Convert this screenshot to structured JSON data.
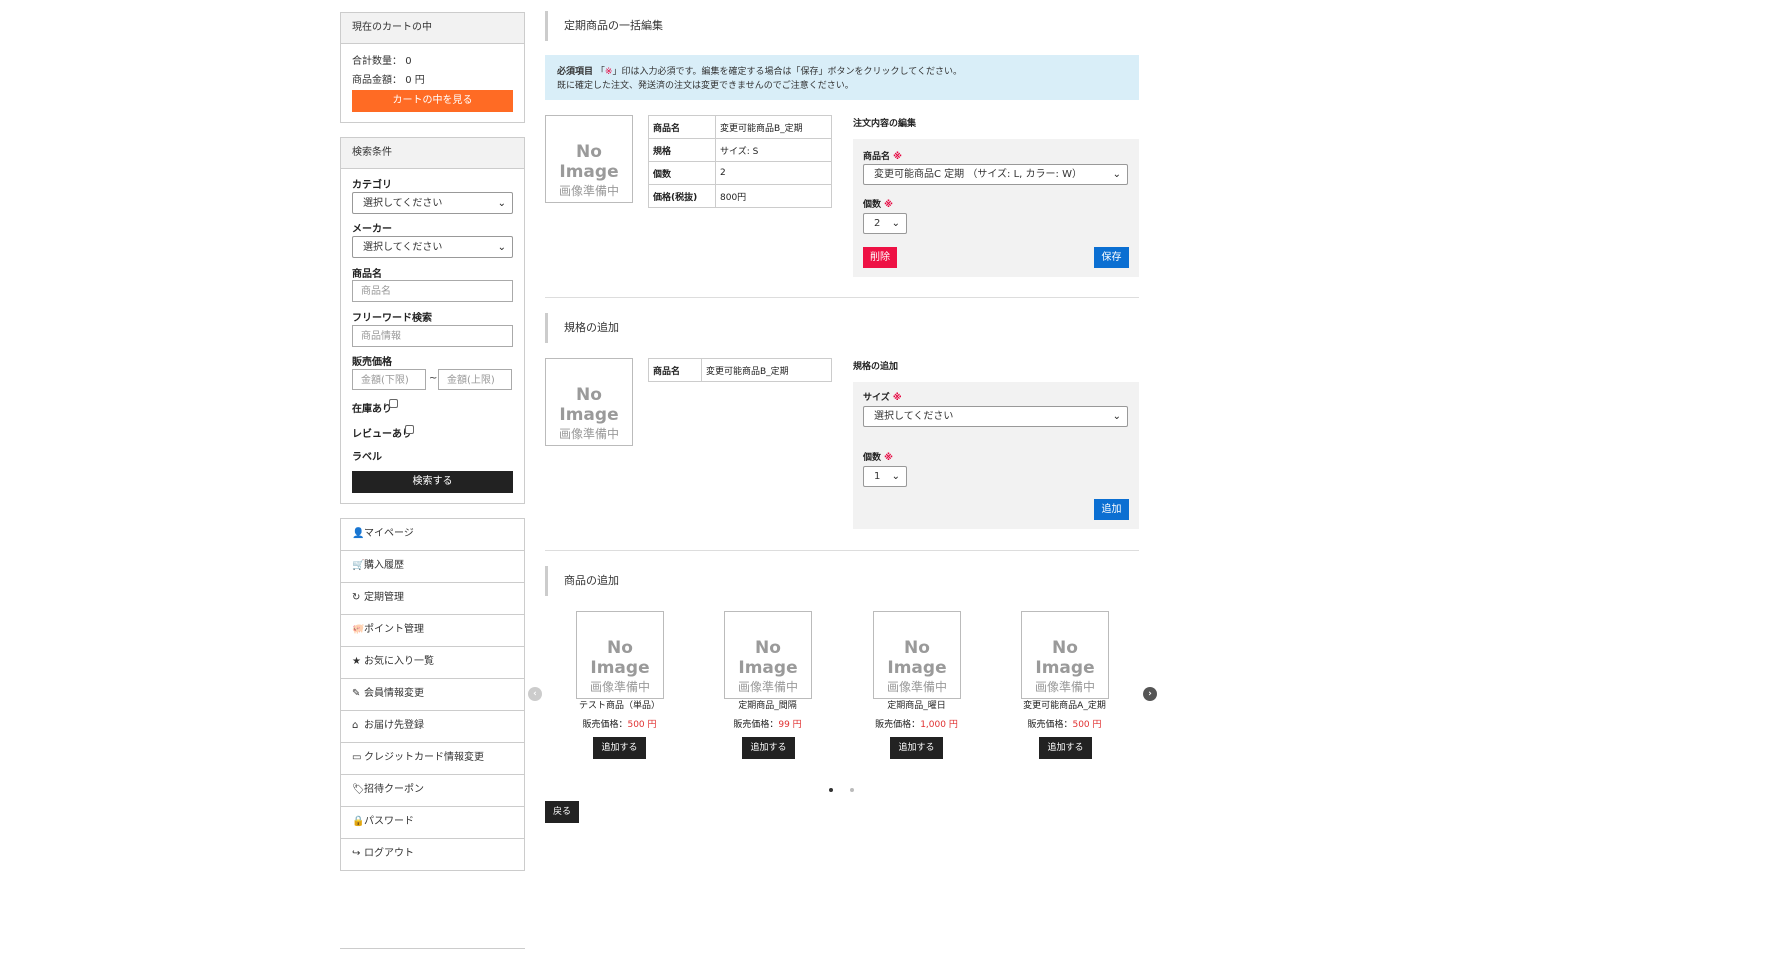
{
  "cart": {
    "title": "現在のカートの中",
    "qty_label": "合計数量：",
    "qty_value": "0",
    "amount_label": "商品金額：",
    "amount_value": "0 円",
    "view_button": "カートの中を見る"
  },
  "search": {
    "title": "検索条件",
    "category_label": "カテゴリ",
    "category_value": "選択してください",
    "maker_label": "メーカー",
    "maker_value": "選択してください",
    "name_label": "商品名",
    "name_placeholder": "商品名",
    "freeword_label": "フリーワード検索",
    "freeword_placeholder": "商品情報",
    "price_label": "販売価格",
    "price_min_placeholder": "金額(下限)",
    "price_sep": "~",
    "price_max_placeholder": "金額(上限)",
    "stock_label": "在庫あり",
    "review_label": "レビューあり",
    "label_label": "ラベル",
    "search_button": "検索する"
  },
  "menu": [
    {
      "icon": "user-icon",
      "glyph": "👤",
      "label": "マイページ"
    },
    {
      "icon": "cart-icon",
      "glyph": "🛒",
      "label": "購入履歴"
    },
    {
      "icon": "refresh-icon",
      "glyph": "↻",
      "label": "定期管理"
    },
    {
      "icon": "piggy-bank-icon",
      "glyph": "🐖",
      "label": "ポイント管理"
    },
    {
      "icon": "star-icon",
      "glyph": "★",
      "label": "お気に入り一覧"
    },
    {
      "icon": "pencil-icon",
      "glyph": "✎",
      "label": "会員情報変更"
    },
    {
      "icon": "home-icon",
      "glyph": "⌂",
      "label": "お届け先登録"
    },
    {
      "icon": "credit-card-icon",
      "glyph": "▭",
      "label": "クレジットカード情報変更"
    },
    {
      "icon": "tags-icon",
      "glyph": "🏷",
      "label": "招待クーポン"
    },
    {
      "icon": "lock-icon",
      "glyph": "🔒",
      "label": "パスワード"
    },
    {
      "icon": "logout-icon",
      "glyph": "↪",
      "label": "ログアウト"
    }
  ],
  "main": {
    "section1_title": "定期商品の一括編集",
    "notice_bold": "必須項目",
    "notice_q1": "「",
    "notice_mark": "※",
    "notice_line1": "」印は入力必須です。編集を確定する場合は「保存」ボタンをクリックしてください。",
    "notice_line2": "既に確定した注文、発送済の注文は変更できませんのでご注意ください。",
    "noimage_en": "No Image",
    "noimage_jp": "画像準備中",
    "item": {
      "name_label": "商品名",
      "name_value": "変更可能商品B_定期",
      "spec_label": "規格",
      "spec_value": "サイズ: S",
      "qty_label": "個数",
      "qty_value": "2",
      "price_label": "価格(税抜)",
      "price_value": "800円"
    },
    "edit": {
      "heading": "注文内容の編集",
      "product_label": "商品名",
      "product_value": "変更可能商品C 定期 （サイズ: L, カラー: W）",
      "qty_label": "個数",
      "qty_value": "2",
      "delete_button": "削除",
      "save_button": "保存",
      "req": "※"
    },
    "section2_title": "規格の追加",
    "spec_item": {
      "name_label": "商品名",
      "name_value": "変更可能商品B_定期"
    },
    "spec_add": {
      "heading": "規格の追加",
      "size_label": "サイズ",
      "size_value": "選択してください",
      "qty_label": "個数",
      "qty_value": "1",
      "add_button": "追加",
      "req": "※"
    },
    "section3_title": "商品の追加",
    "products": [
      {
        "name": "テスト商品（単品）",
        "price_label": "販売価格：",
        "price": "500 円",
        "button": "追加する"
      },
      {
        "name": "定期商品_間隔",
        "price_label": "販売価格：",
        "price": "99 円",
        "button": "追加する"
      },
      {
        "name": "定期商品_曜日",
        "price_label": "販売価格：",
        "price": "1,000 円",
        "button": "追加する"
      },
      {
        "name": "変更可能商品A_定期",
        "price_label": "販売価格：",
        "price": "500 円",
        "button": "追加する"
      }
    ],
    "carousel": {
      "prev_glyph": "‹",
      "next_glyph": "›",
      "active_dot": 0,
      "dot_count": 2
    },
    "back_button": "戻る"
  }
}
